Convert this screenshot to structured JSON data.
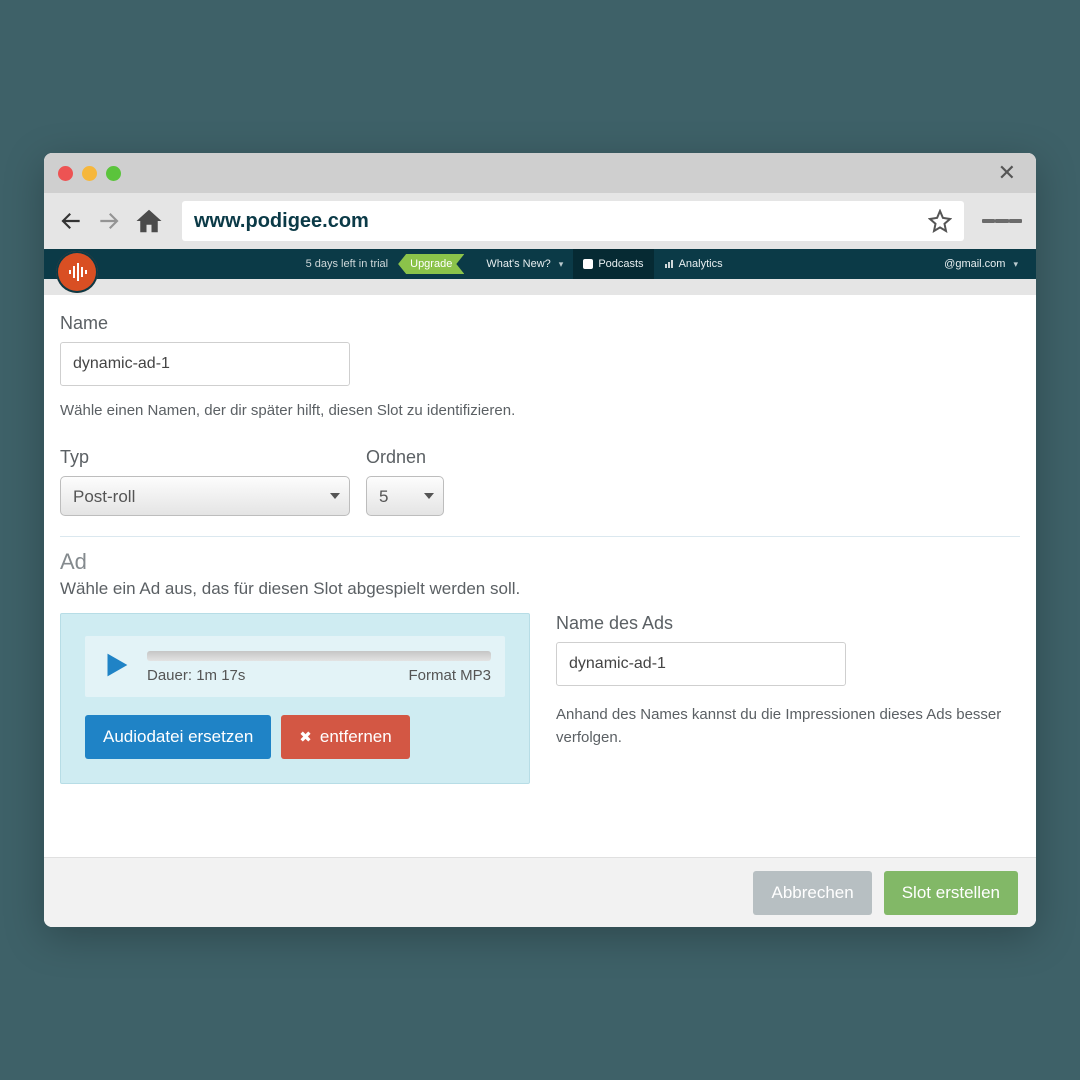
{
  "browser": {
    "url": "www.podigee.com"
  },
  "topbar": {
    "trial": "5 days left in trial",
    "upgrade": "Upgrade",
    "whats_new": "What's New?",
    "podcasts": "Podcasts",
    "analytics": "Analytics",
    "account": "@gmail.com"
  },
  "form": {
    "name_label": "Name",
    "name_value": "dynamic-ad-1",
    "name_help": "Wähle einen Namen, der dir später hilft, diesen Slot zu identifizieren.",
    "typ_label": "Typ",
    "typ_value": "Post-roll",
    "ordnen_label": "Ordnen",
    "ordnen_value": "5"
  },
  "ad": {
    "section_title": "Ad",
    "section_sub": "Wähle ein Ad aus, das für diesen Slot abgespielt werden soll.",
    "duration_label": "Dauer: 1m 17s",
    "format_label": "Format MP3",
    "replace_btn": "Audiodatei ersetzen",
    "remove_btn": "entfernen",
    "name_label": "Name des Ads",
    "name_value": "dynamic-ad-1",
    "name_help": "Anhand des Names kannst du die Impressionen dieses Ads besser verfolgen."
  },
  "footer": {
    "cancel": "Abbrechen",
    "create": "Slot erstellen"
  }
}
